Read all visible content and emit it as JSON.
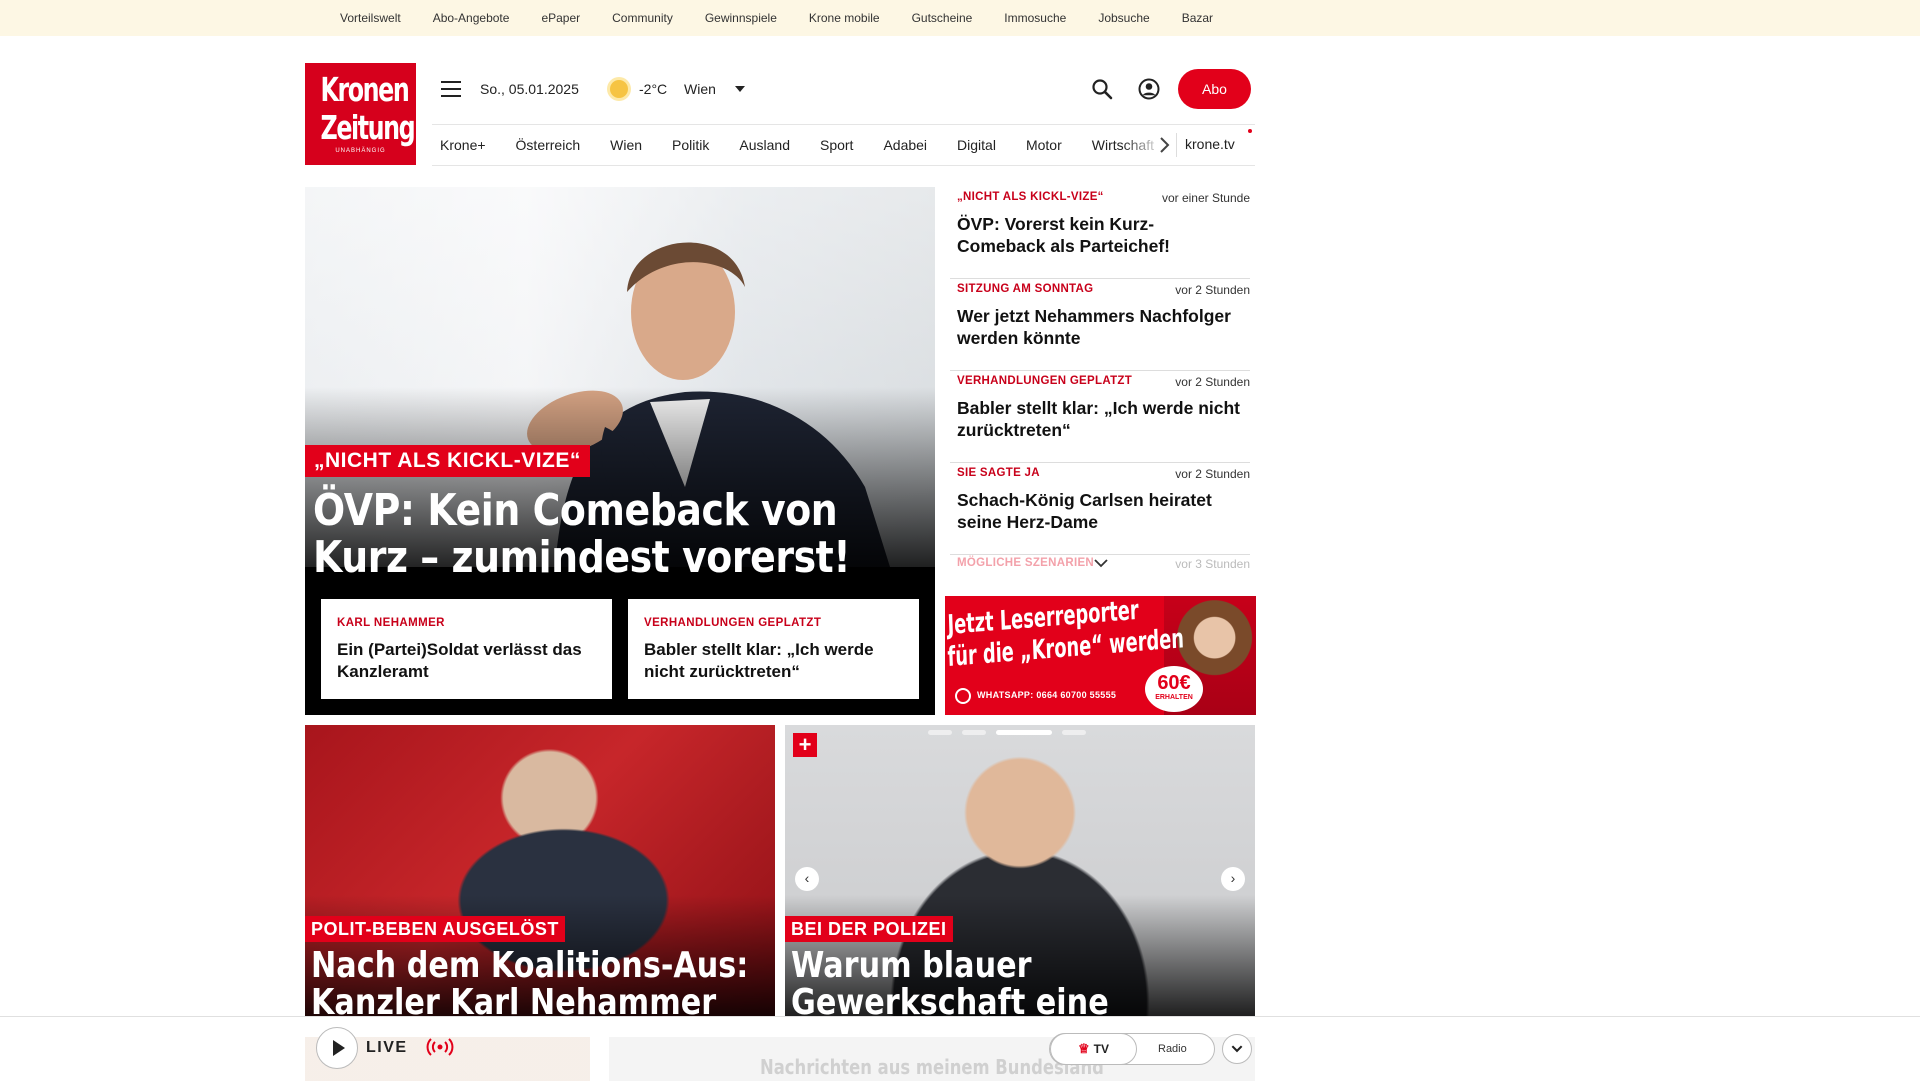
{
  "topbar": {
    "links": [
      "Vorteilswelt",
      "Abo-Angebote",
      "ePaper",
      "Community",
      "Gewinnspiele",
      "Krone mobile",
      "Gutscheine",
      "Immosuche",
      "Jobsuche",
      "Bazar"
    ]
  },
  "logo": {
    "line1": "Kronen",
    "line2": "Zeitung",
    "line3": "UNABHÄNGIG"
  },
  "header": {
    "date": "So., 05.01.2025",
    "temperature": "-2°C",
    "city": "Wien",
    "abo_label": "Abo"
  },
  "nav": {
    "items": [
      "Krone+",
      "Österreich",
      "Wien",
      "Politik",
      "Ausland",
      "Sport",
      "Adabei",
      "Digital",
      "Motor",
      "Wirtschaft"
    ],
    "tv_label": "krone.tv"
  },
  "hero": {
    "kicker": "„NICHT ALS KICKL-VIZE“",
    "title": "ÖVP: Kein Comeback von Kurz – zumindest vorerst!",
    "cards": [
      {
        "kicker": "KARL NEHAMMER",
        "title": "Ein (Partei)Soldat verlässt das Kanzleramt"
      },
      {
        "kicker": "VERHANDLUNGEN GEPLATZT",
        "title": "Babler stellt klar: „Ich werde nicht zurücktreten“"
      }
    ]
  },
  "side_list": {
    "items": [
      {
        "kicker": "„NICHT ALS KICKL-VIZE“",
        "time": "vor einer Stunde",
        "title": "ÖVP: Vorerst kein Kurz-Comeback als Parteichef!"
      },
      {
        "kicker": "SITZUNG AM SONNTAG",
        "time": "vor 2 Stunden",
        "title": "Wer jetzt Nehammers Nachfolger werden könnte"
      },
      {
        "kicker": "VERHANDLUNGEN GEPLATZT",
        "time": "vor 2 Stunden",
        "title": "Babler stellt klar: „Ich werde nicht zurücktreten“"
      },
      {
        "kicker": "SIE SAGTE JA",
        "time": "vor 2 Stunden",
        "title": "Schach-König Carlsen heiratet seine Herz-Dame"
      }
    ],
    "faded": {
      "kicker": "MÖGLICHE SZENARIEN",
      "time": "vor 3 Stunden"
    }
  },
  "ad": {
    "line1": "Jetzt Leserreporter",
    "line2": "für die „Krone“ werden",
    "whatsapp": "WHATSAPP: 0664 60700 55555",
    "badge_amount": "60€",
    "badge_label": "ERHALTEN"
  },
  "stories": [
    {
      "kicker": "POLIT-BEBEN AUSGELÖST",
      "title": "Nach dem Koalitions-Aus: Kanzler Karl Nehammer tritt ab"
    },
    {
      "kicker": "BEI DER POLIZEI",
      "title": "Warum blauer Gewerkschaft eine Austrittswelle droht"
    }
  ],
  "player": {
    "live_label": "LIVE",
    "tv_label": "TV",
    "radio_label": "Radio",
    "peek_text": "Nachrichten aus meinem Bundesland"
  },
  "colors": {
    "brand_red": "#e2001a",
    "topbar_bg": "#fdf7e4"
  }
}
